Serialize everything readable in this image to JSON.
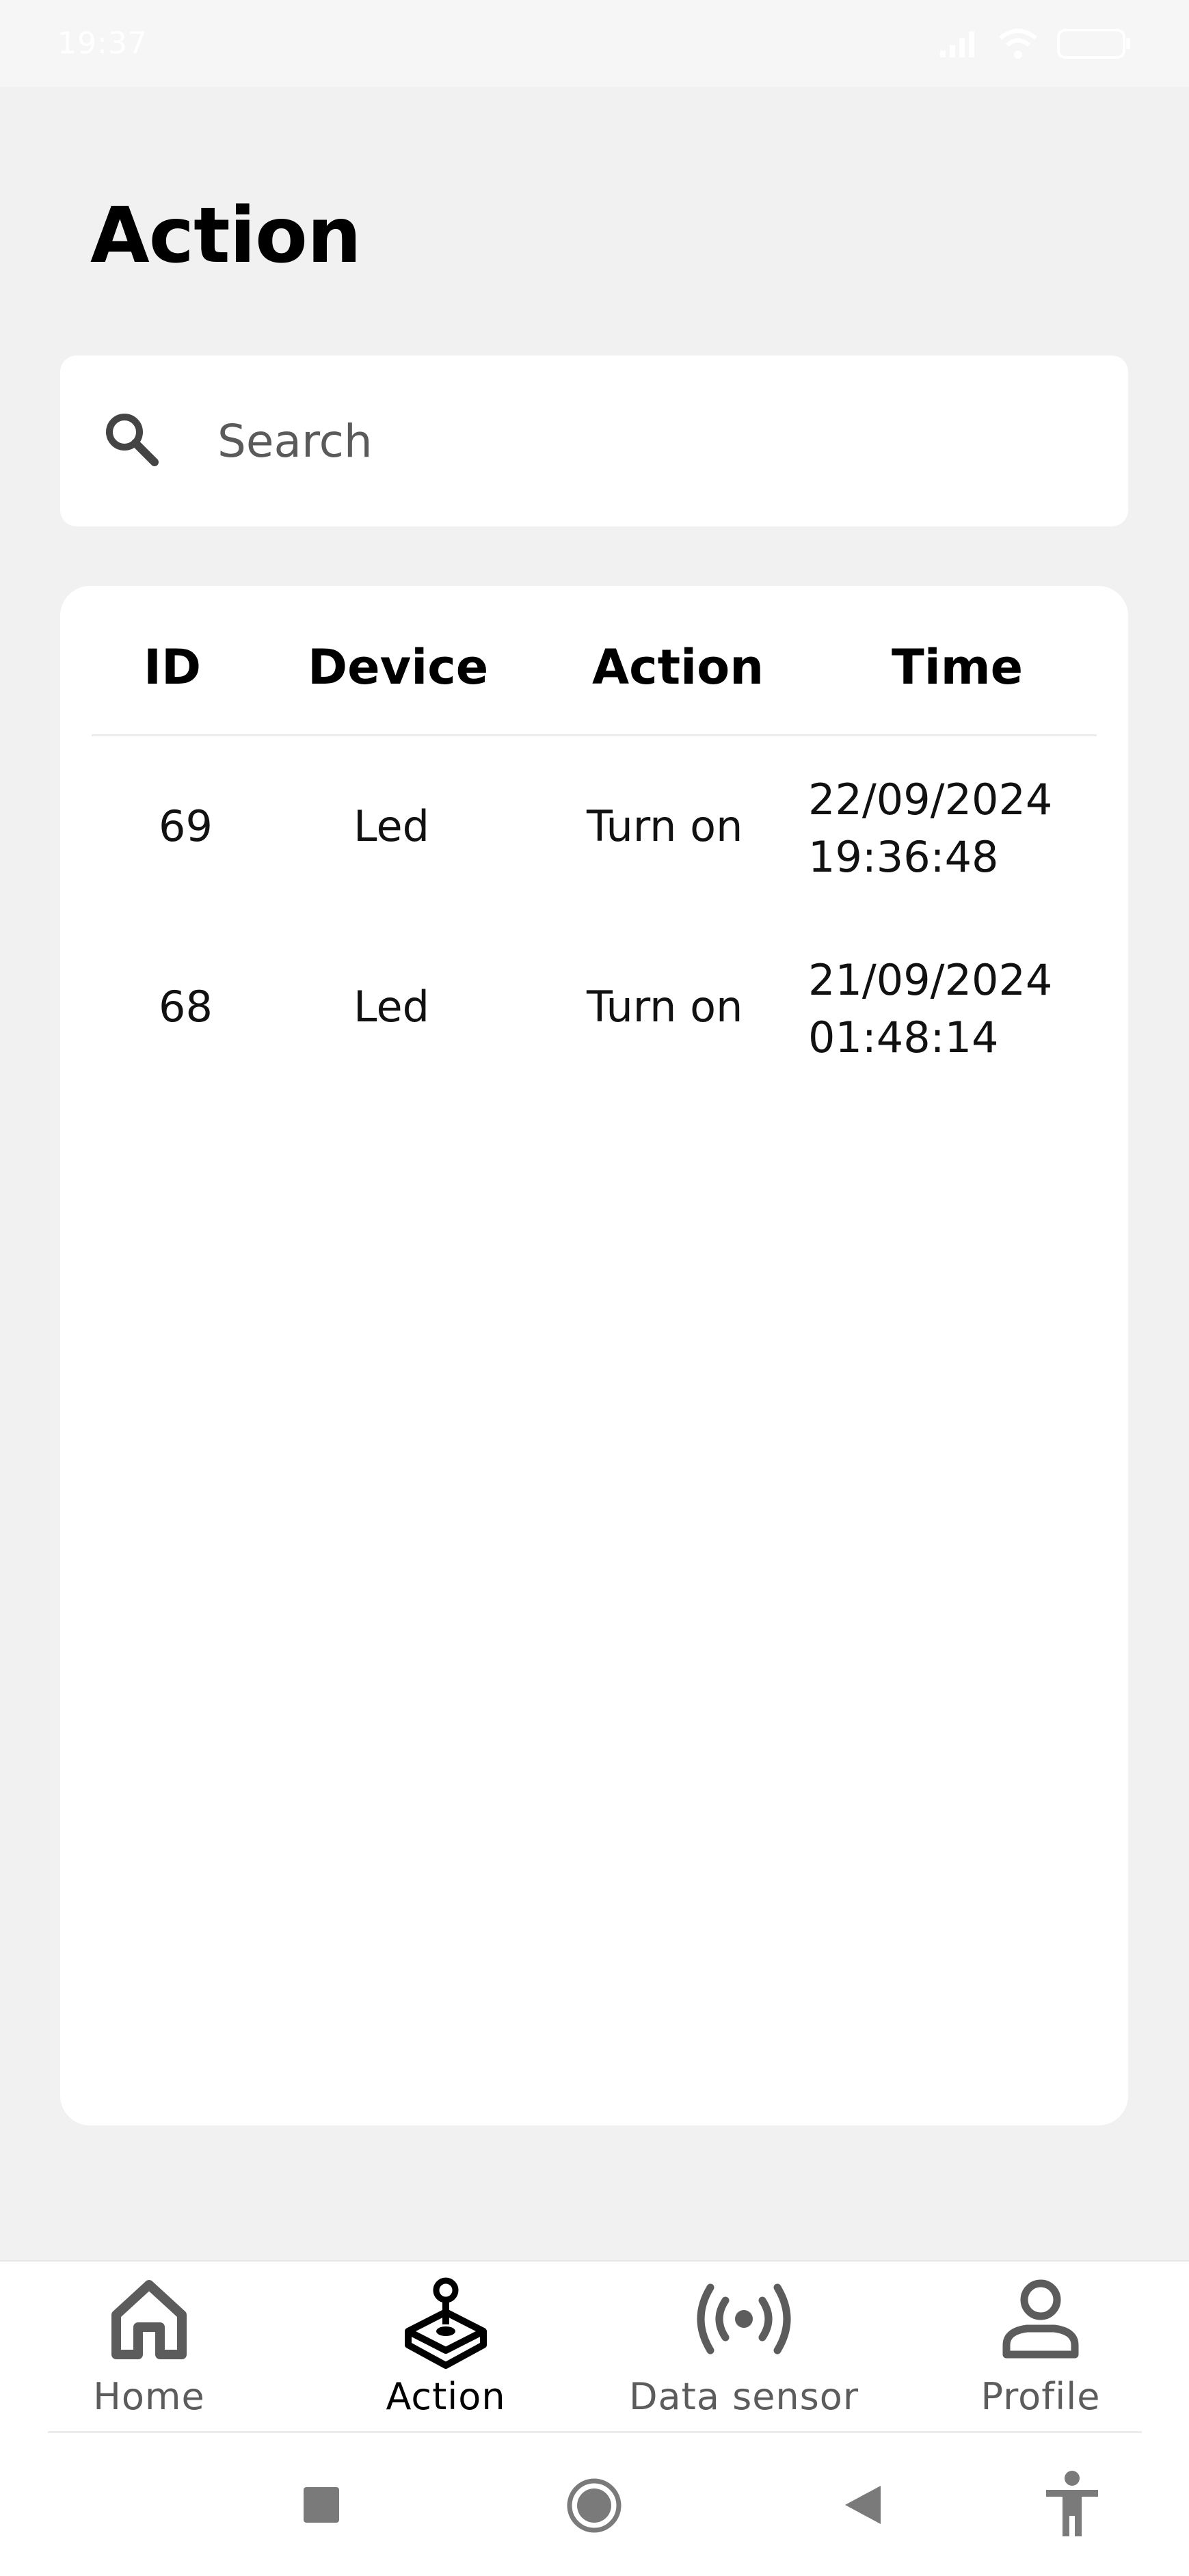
{
  "status_bar": {
    "time": "19:37"
  },
  "page": {
    "title": "Action"
  },
  "search": {
    "placeholder": "Search",
    "value": ""
  },
  "table": {
    "columns": [
      "ID",
      "Device",
      "Action",
      "Time"
    ],
    "rows": [
      {
        "id": "69",
        "device": "Led",
        "action": "Turn on",
        "date": "22/09/2024",
        "time": "19:36:48"
      },
      {
        "id": "68",
        "device": "Led",
        "action": "Turn on",
        "date": "21/09/2024",
        "time": "01:48:14"
      }
    ]
  },
  "bottom_nav": {
    "items": [
      {
        "label": "Home",
        "icon": "home-icon",
        "active": false
      },
      {
        "label": "Action",
        "icon": "joystick-icon",
        "active": true
      },
      {
        "label": "Data sensor",
        "icon": "sensor-icon",
        "active": false
      },
      {
        "label": "Profile",
        "icon": "person-icon",
        "active": false
      }
    ]
  },
  "colors": {
    "background": "#f1f1f1",
    "card": "#ffffff",
    "active": "#000000",
    "inactive": "#5c5c5c"
  }
}
